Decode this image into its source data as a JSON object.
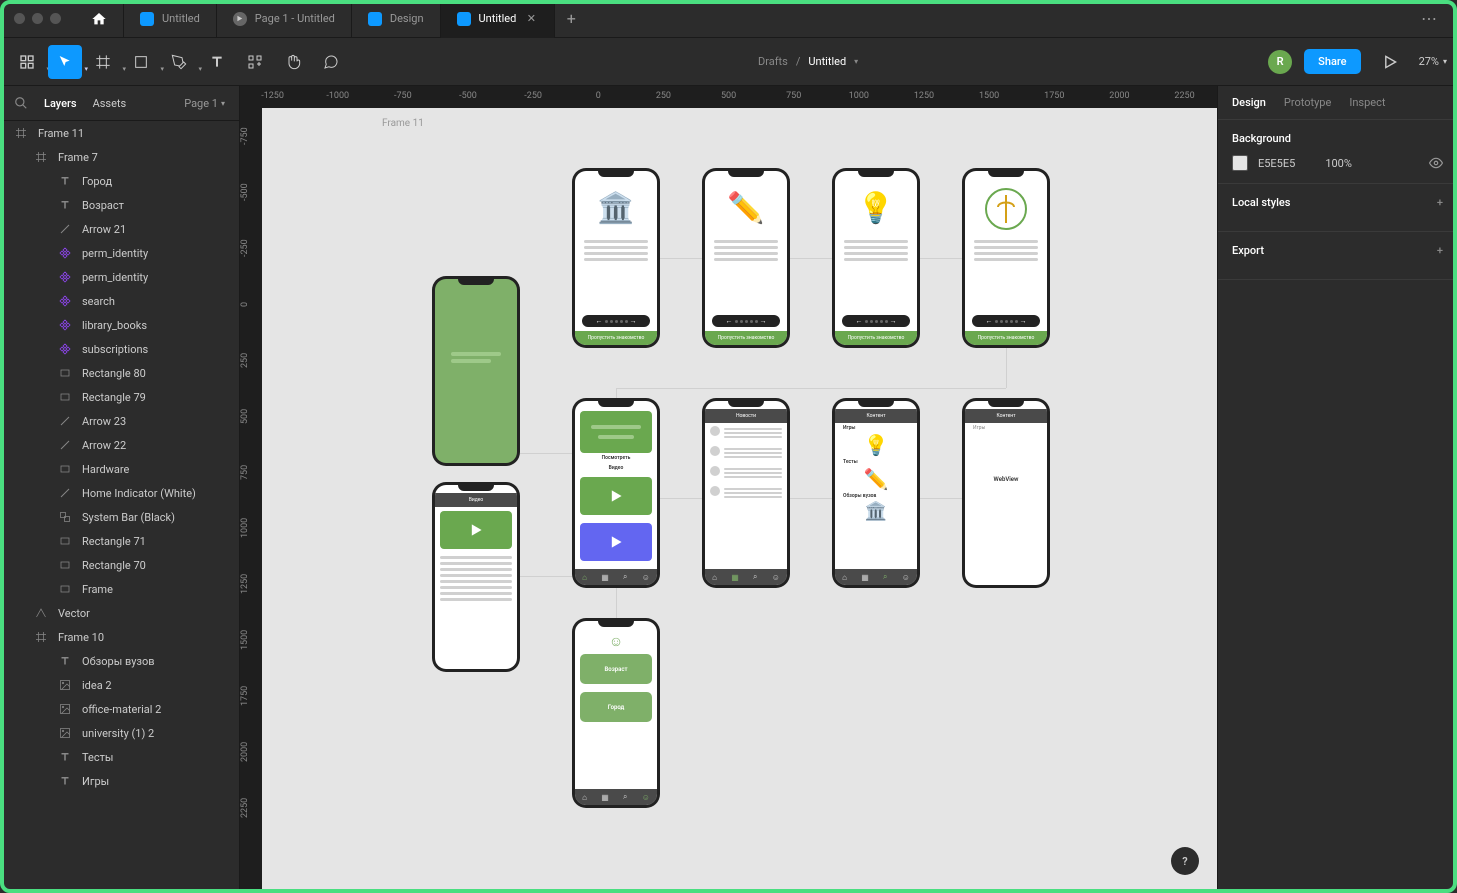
{
  "titlebar": {
    "tabs": [
      {
        "label": "Untitled",
        "type": "file"
      },
      {
        "label": "Page 1 - Untitled",
        "type": "proto"
      },
      {
        "label": "Design",
        "type": "file"
      },
      {
        "label": "Untitled",
        "type": "file",
        "active": true
      }
    ]
  },
  "toolbar": {
    "breadcrumb_root": "Drafts",
    "breadcrumb_sep": "/",
    "breadcrumb_file": "Untitled",
    "share": "Share",
    "zoom": "27%",
    "avatar_letter": "R"
  },
  "left": {
    "tab_layers": "Layers",
    "tab_assets": "Assets",
    "page_selector": "Page 1",
    "layers": [
      {
        "name": "Frame 11",
        "depth": 0,
        "icon": "frame"
      },
      {
        "name": "Frame 7",
        "depth": 1,
        "icon": "frame"
      },
      {
        "name": "Город",
        "depth": 2,
        "icon": "text"
      },
      {
        "name": "Возраст",
        "depth": 2,
        "icon": "text"
      },
      {
        "name": "Arrow 21",
        "depth": 2,
        "icon": "line"
      },
      {
        "name": "perm_identity",
        "depth": 2,
        "icon": "comp"
      },
      {
        "name": "perm_identity",
        "depth": 2,
        "icon": "comp"
      },
      {
        "name": "search",
        "depth": 2,
        "icon": "comp"
      },
      {
        "name": "library_books",
        "depth": 2,
        "icon": "comp"
      },
      {
        "name": "subscriptions",
        "depth": 2,
        "icon": "comp"
      },
      {
        "name": "Rectangle 80",
        "depth": 2,
        "icon": "rect"
      },
      {
        "name": "Rectangle 79",
        "depth": 2,
        "icon": "rect"
      },
      {
        "name": "Arrow 23",
        "depth": 2,
        "icon": "line"
      },
      {
        "name": "Arrow 22",
        "depth": 2,
        "icon": "line"
      },
      {
        "name": "Hardware",
        "depth": 2,
        "icon": "rect"
      },
      {
        "name": "Home Indicator (White)",
        "depth": 2,
        "icon": "line"
      },
      {
        "name": "System Bar (Black)",
        "depth": 2,
        "icon": "group"
      },
      {
        "name": "Rectangle 71",
        "depth": 2,
        "icon": "rect"
      },
      {
        "name": "Rectangle 70",
        "depth": 2,
        "icon": "rect"
      },
      {
        "name": "Frame",
        "depth": 2,
        "icon": "rect"
      },
      {
        "name": "Vector",
        "depth": 1,
        "icon": "vector"
      },
      {
        "name": "Frame 10",
        "depth": 1,
        "icon": "frame"
      },
      {
        "name": "Обзоры вузов",
        "depth": 2,
        "icon": "text"
      },
      {
        "name": "idea 2",
        "depth": 2,
        "icon": "image"
      },
      {
        "name": "office-material 2",
        "depth": 2,
        "icon": "image"
      },
      {
        "name": "university (1) 2",
        "depth": 2,
        "icon": "image"
      },
      {
        "name": "Тесты",
        "depth": 2,
        "icon": "text"
      },
      {
        "name": "Игры",
        "depth": 2,
        "icon": "text"
      }
    ]
  },
  "ruler_h": [
    "-1250",
    "-1000",
    "-750",
    "-500",
    "-250",
    "0",
    "250",
    "500",
    "750",
    "1000",
    "1250",
    "1500",
    "1750",
    "2000",
    "2250"
  ],
  "ruler_v": [
    "-750",
    "-500",
    "-250",
    "0",
    "250",
    "500",
    "750",
    "1000",
    "1250",
    "1500",
    "1750",
    "2000",
    "2250"
  ],
  "canvas": {
    "frame_label": "Frame 11",
    "onboard_skip": "Пропустить знакомство",
    "video_header": "Видео",
    "news_header": "Новости",
    "content_header": "Контент",
    "content_header2": "Контент",
    "games_label": "Игры",
    "tests_label": "Тесты",
    "reviews_label": "Обзоры вузов",
    "webview": "WebView",
    "age_label": "Возраст",
    "city_label": "Город",
    "video_section": "Видео",
    "watch_label": "Посмотреть"
  },
  "right": {
    "tab_design": "Design",
    "tab_prototype": "Prototype",
    "tab_inspect": "Inspect",
    "bg_header": "Background",
    "bg_hex": "E5E5E5",
    "bg_opacity": "100%",
    "local_styles": "Local styles",
    "export": "Export"
  },
  "help": "?"
}
